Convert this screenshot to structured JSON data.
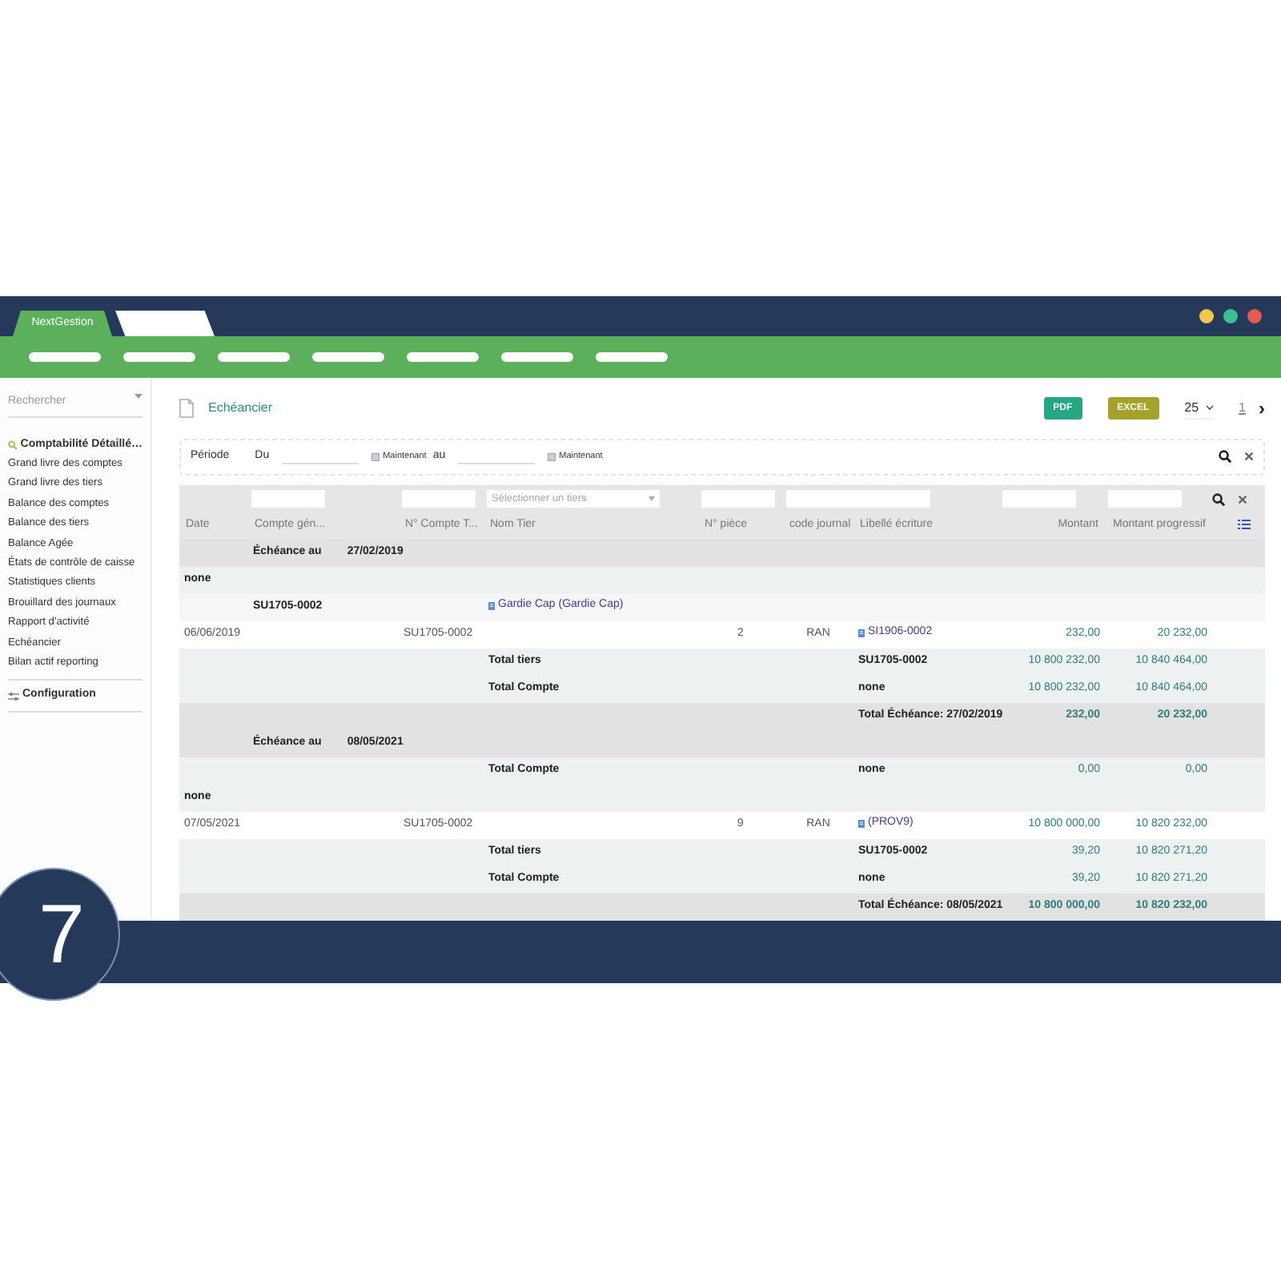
{
  "browser": {
    "tabs": [
      {
        "label": "NextGestion",
        "selected": true
      },
      {
        "selected": false
      }
    ]
  },
  "sidebar": {
    "search": {
      "placeholder": "Rechercher"
    },
    "section": "Comptabilité Détaillé…",
    "items": [
      "Grand livre des comptes",
      "Grand livre des tiers",
      "Balance des comptes",
      "Balance des tiers",
      "Balance Agée",
      "États de contrôle de caisse",
      "Statistiques clients",
      "Brouillard des journaux",
      "Rapport d'activité",
      "Echéancier",
      "Bilan actif reporting"
    ],
    "config": "Configuration"
  },
  "page": {
    "title": "Echéancier",
    "pdf": "PDF",
    "excel": "EXCEL",
    "page_size": "25",
    "page": "1",
    "next": "›"
  },
  "filters": {
    "label": "Période",
    "from": "Du",
    "from_now": "Maintenant",
    "to": "au",
    "to_now": "Maintenant"
  },
  "table": {
    "columns": [
      {
        "label": "Date"
      },
      {
        "label": "Compte gén...",
        "kind": "input"
      },
      {
        "label": "N° Compte T...",
        "kind": "input"
      },
      {
        "label": "Nom Tier",
        "kind": "select",
        "placeholder": "Sélectionner un tiers"
      },
      {
        "label": "N° pièce",
        "kind": "input"
      },
      {
        "label": "code journal",
        "kind": "input"
      },
      {
        "label": "Libellé écriture",
        "kind": "input"
      },
      {
        "label": "Montant",
        "kind": "input"
      },
      {
        "label": "Montant progressif",
        "kind": "input"
      }
    ],
    "rows": [
      {
        "kind": "group",
        "compte_general": "Échéance au",
        "echeance_date": "27/02/2019"
      },
      {
        "kind": "subtotal",
        "date": "none"
      },
      {
        "kind": "light",
        "compte_general": "SU1705-0002",
        "nom_tier": {
          "kind": "link",
          "text": "Gardie Cap (Gardie Cap)"
        }
      },
      {
        "kind": "entry",
        "date": "06/06/2019",
        "n_compte_tiers": "SU1705-0002",
        "n_piece": "2",
        "code_journal": "RAN",
        "libelle": {
          "kind": "link",
          "text": "SI1906-0002"
        },
        "montant": "232,00",
        "montant_progressif": "20 232,00"
      },
      {
        "kind": "subtotal",
        "nom_tier": "Total tiers",
        "libelle": "SU1705-0002",
        "montant": "10 800 232,00",
        "montant_progressif": "10 840 464,00"
      },
      {
        "kind": "subtotal",
        "nom_tier": "Total Compte",
        "libelle": "none",
        "montant": "10 800 232,00",
        "montant_progressif": "10 840 464,00"
      },
      {
        "kind": "group",
        "libelle": "Total Échéance: 27/02/2019",
        "montant": "232,00",
        "montant_progressif": "20 232,00"
      },
      {
        "kind": "group",
        "compte_general": "Échéance au",
        "echeance_date": "08/05/2021"
      },
      {
        "kind": "subtotal",
        "nom_tier": "Total Compte",
        "libelle": "none",
        "montant": "0,00",
        "montant_progressif": "0,00"
      },
      {
        "kind": "subtotal",
        "date": "none"
      },
      {
        "kind": "entry",
        "date": "07/05/2021",
        "n_compte_tiers": "SU1705-0002",
        "n_piece": "9",
        "code_journal": "RAN",
        "libelle": {
          "kind": "link",
          "text": "(PROV9)"
        },
        "montant": "10 800 000,00",
        "montant_progressif": "10 820 232,00"
      },
      {
        "kind": "subtotal",
        "nom_tier": "Total tiers",
        "libelle": "SU1705-0002",
        "montant": "39,20",
        "montant_progressif": "10 820 271,20"
      },
      {
        "kind": "subtotal",
        "nom_tier": "Total Compte",
        "libelle": "none",
        "montant": "39,20",
        "montant_progressif": "10 820 271,20"
      },
      {
        "kind": "group",
        "libelle": "Total Échéance: 08/05/2021",
        "montant": "10 800 000,00",
        "montant_progressif": "10 820 232,00"
      }
    ]
  },
  "step_number": "7"
}
